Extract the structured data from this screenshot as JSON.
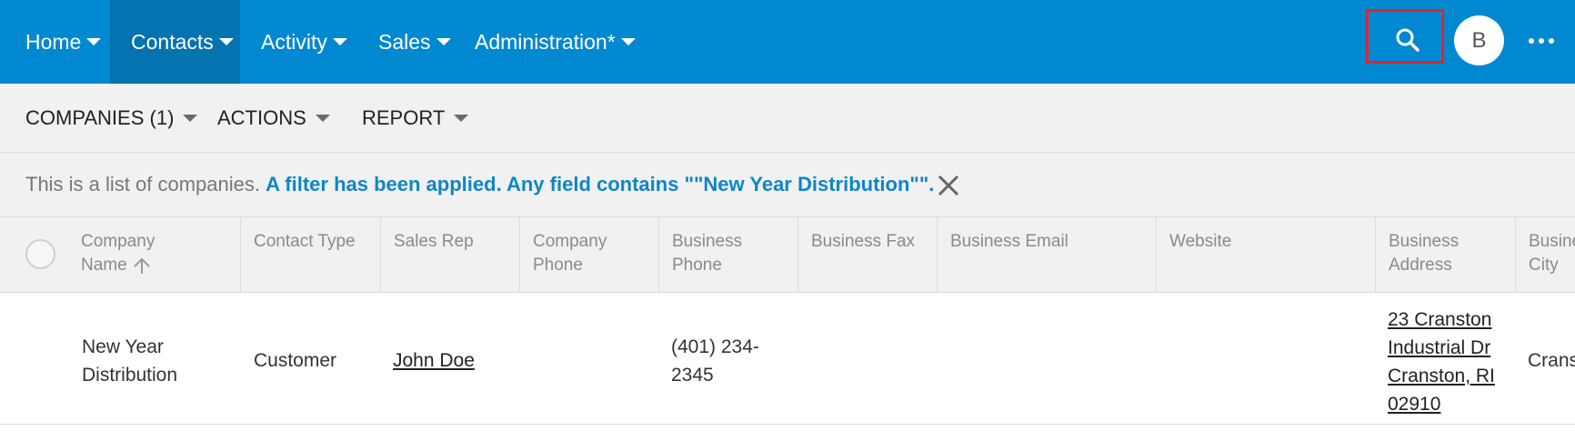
{
  "nav": {
    "items": [
      {
        "label": "Home"
      },
      {
        "label": "Contacts"
      },
      {
        "label": "Activity"
      },
      {
        "label": "Sales"
      },
      {
        "label": "Administration*"
      }
    ],
    "avatar_initial": "B",
    "colors": {
      "bar": "#0088d1",
      "active": "#0473b0",
      "highlight": "#e0242e"
    }
  },
  "toolbar": {
    "companies": "COMPANIES (1)",
    "actions": "ACTIONS",
    "report": "REPORT"
  },
  "filter": {
    "prefix": "This is a list of companies.",
    "applied": "A filter has been applied. Any field contains \"\"New Year Distribution\"\"."
  },
  "table": {
    "columns": [
      {
        "line1": "Company",
        "line2": "Name"
      },
      {
        "line1": "Contact Type",
        "line2": ""
      },
      {
        "line1": "Sales Rep",
        "line2": ""
      },
      {
        "line1": "Company",
        "line2": "Phone"
      },
      {
        "line1": "Business",
        "line2": "Phone"
      },
      {
        "line1": "Business Fax",
        "line2": ""
      },
      {
        "line1": "Business Email",
        "line2": ""
      },
      {
        "line1": "Website",
        "line2": ""
      },
      {
        "line1": "Business",
        "line2": "Address"
      },
      {
        "line1": "Busine",
        "line2": "City"
      }
    ],
    "rows": [
      {
        "company_name_1": "New Year",
        "company_name_2": "Distribution",
        "contact_type": "Customer",
        "sales_rep": "John Doe",
        "business_phone_1": "(401) 234-",
        "business_phone_2": "2345",
        "address_1": "23 Cranston",
        "address_2": "Industrial Dr",
        "address_3": "Cranston, RI",
        "address_4": "02910",
        "city": "Crans"
      }
    ]
  }
}
